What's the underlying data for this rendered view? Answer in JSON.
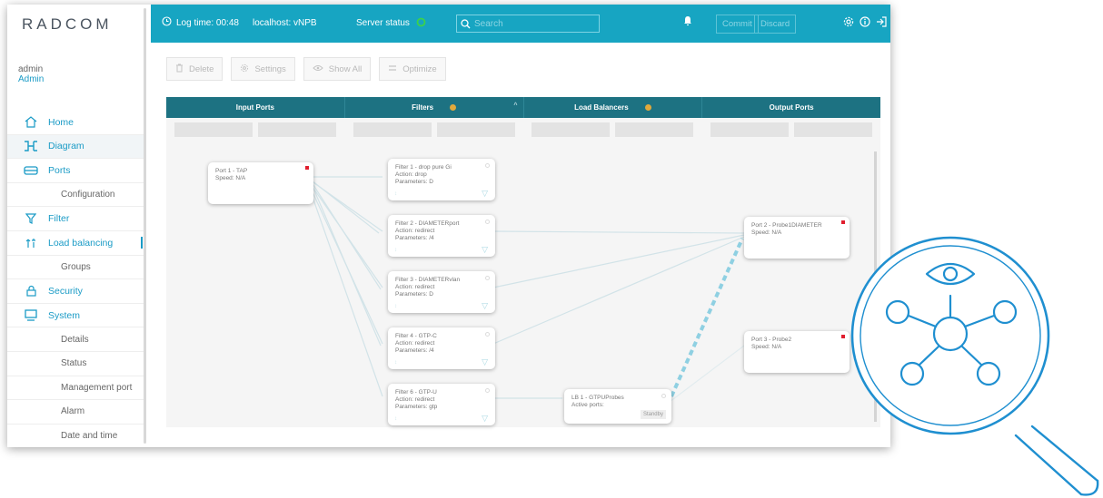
{
  "brand": {
    "logo": "RADCOM",
    "accent": "#17a5c2",
    "header_dark": "#1d7282",
    "alert_red": "#e01e2e"
  },
  "user": {
    "name": "admin",
    "role": "Admin"
  },
  "nav": {
    "home": "Home",
    "diagram": "Diagram",
    "ports": "Ports",
    "configuration": "Configuration",
    "filter": "Filter",
    "load_balancing": "Load balancing",
    "groups": "Groups",
    "security": "Security",
    "system": "System",
    "details": "Details",
    "status": "Status",
    "management_port": "Management port",
    "alarm": "Alarm",
    "date_time": "Date and time"
  },
  "topbar": {
    "log_time": "Log time: 00:48",
    "host": "localhost: vNPB",
    "server_status": "Server status",
    "search_placeholder": "Search",
    "commit": "Commit",
    "discard": "Discard"
  },
  "toolbar": {
    "delete": "Delete",
    "settings": "Settings",
    "show_all": "Show All",
    "optimize": "Optimize"
  },
  "columns": {
    "input_ports": "Input Ports",
    "filters": "Filters",
    "load_balancers": "Load Balancers",
    "output_ports": "Output Ports"
  },
  "nodes": {
    "port1": {
      "title": "Port 1 - TAP",
      "line1": "Speed: N/A"
    },
    "filter1": {
      "title": "Filter 1 - drop pure Gi",
      "line1": "Action: drop",
      "line2": "Parameters: D"
    },
    "filter2": {
      "title": "Filter 2 - DIAMETERport",
      "line1": "Action: redirect",
      "line2": "Parameters: /4"
    },
    "filter3": {
      "title": "Filter 3 - DIAMETERvlan",
      "line1": "Action: redirect",
      "line2": "Parameters: D"
    },
    "filter4": {
      "title": "Filter 4 - GTP-C",
      "line1": "Action: redirect",
      "line2": "Parameters: /4"
    },
    "filter6": {
      "title": "Filter 6 - GTP-U",
      "line1": "Action: redirect",
      "line2": "Parameters: gtp"
    },
    "lb1": {
      "title": "LB 1 - GTPUProbes",
      "line1": "Active ports:",
      "standby": "Standby"
    },
    "port2": {
      "title": "Port 2 - Probe1DIAMETER",
      "line1": "Speed: N/A"
    },
    "port3": {
      "title": "Port 3 - Probe2",
      "line1": "Speed: N/A"
    }
  }
}
